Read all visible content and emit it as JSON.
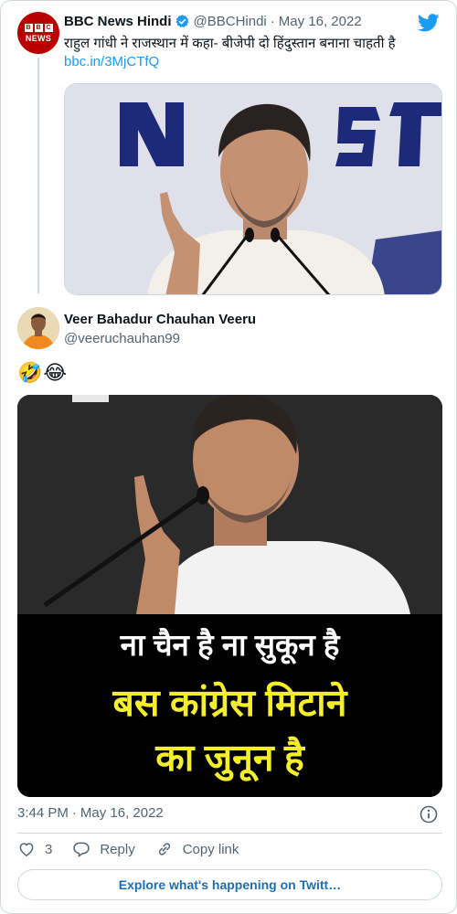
{
  "parent_tweet": {
    "avatar_blocks": [
      "B",
      "B",
      "C"
    ],
    "avatar_label": "NEWS",
    "author_name": "BBC News Hindi",
    "handle": "@BBCHindi",
    "separator": "·",
    "date": "May 16, 2022",
    "text": "राहुल गांधी ने राजस्थान में कहा- बीजेपी दो हिंदुस्तान बनाना चाहती है",
    "link": "bbc.in/3MjCTfQ"
  },
  "tweet": {
    "author_name": "Veer Bahadur Chauhan Veeru",
    "handle": "@veeruchauhan99",
    "emoji": "🤣😂",
    "image_caption": {
      "line1": "ना चैन है ना सुकून है",
      "line2": "बस कांग्रेस मिटाने",
      "line3": "का जुनून है"
    },
    "time": "3:44 PM",
    "separator": "·",
    "date": "May 16, 2022"
  },
  "actions": {
    "like_count": "3",
    "reply_label": "Reply",
    "copy_label": "Copy link"
  },
  "explore_label": "Explore what's happening on Twitt…",
  "icons": [
    "twitter-bird-icon",
    "verified-badge-icon",
    "info-icon",
    "heart-icon",
    "reply-bubble-icon",
    "link-icon"
  ],
  "colors": {
    "twitter_blue": "#1d9bf0",
    "bbc_red": "#b80000",
    "caption_yellow": "#f4ef2a",
    "secondary_text": "#536471"
  }
}
